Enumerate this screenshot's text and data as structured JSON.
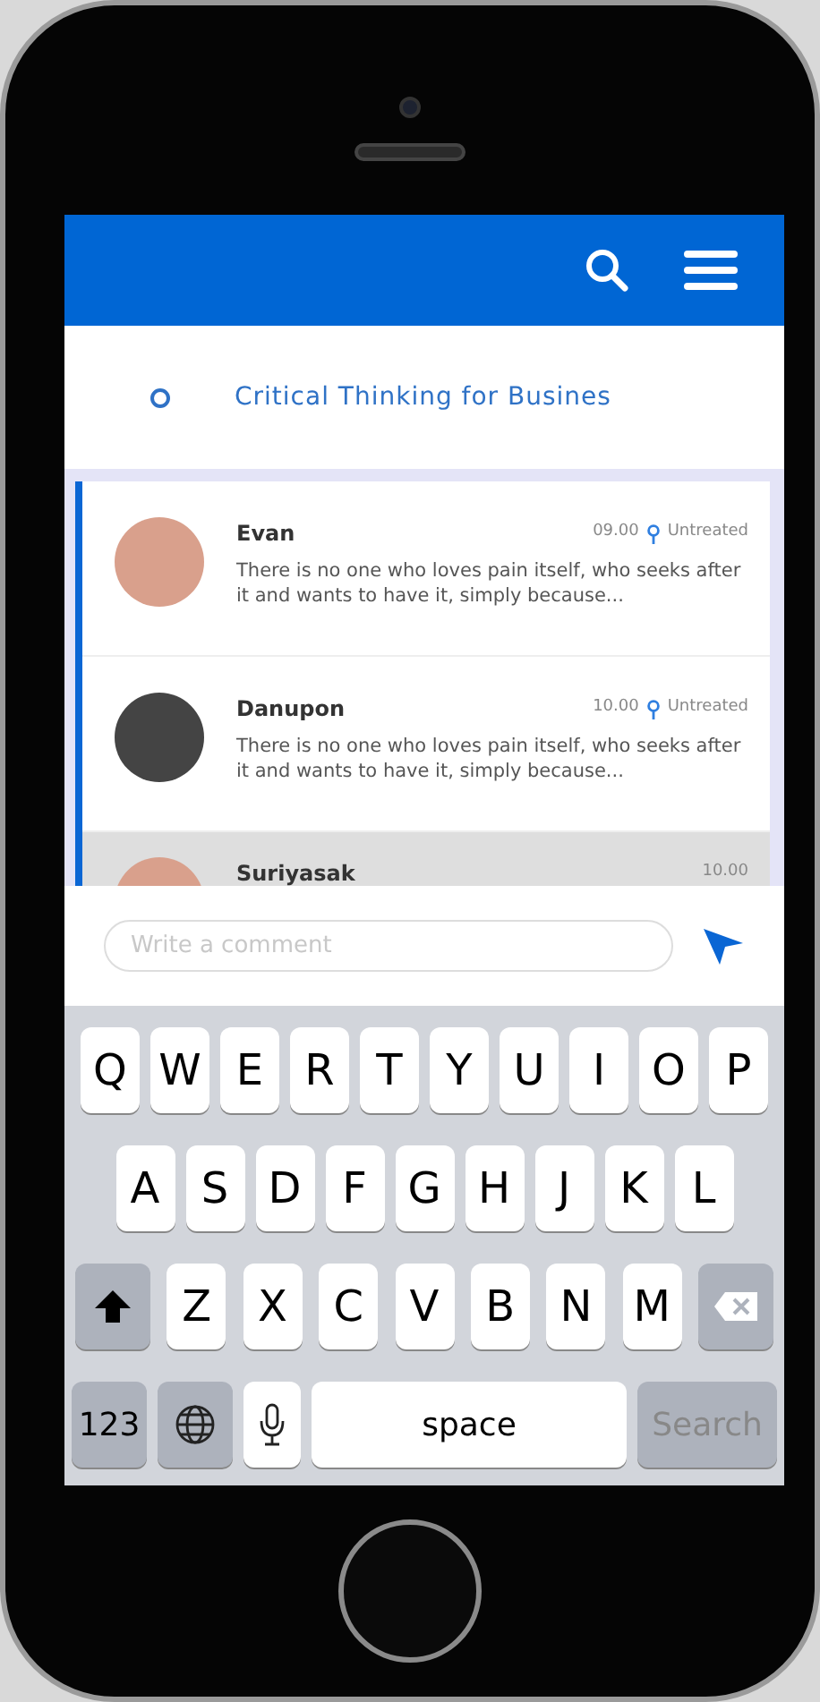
{
  "header": {
    "title": "Critical Thinking for Busines"
  },
  "messages": [
    {
      "name": "Evan",
      "time": "09.00",
      "status": "Untreated",
      "text": "There is no one who loves pain itself, who seeks after it and wants to have it, simply because...",
      "selected": false
    },
    {
      "name": "Danupon",
      "time": "10.00",
      "status": "Untreated",
      "text": "There is no one who loves pain itself, who seeks after it and wants to have it, simply because...",
      "selected": false
    },
    {
      "name": "Suriyasak",
      "time": "10.00",
      "selected": true
    }
  ],
  "comment": {
    "placeholder": "Write a comment"
  },
  "keyboard": [
    [
      {
        "kind": "letter",
        "label": "Q"
      },
      {
        "kind": "letter",
        "label": "W"
      },
      {
        "kind": "letter",
        "label": "E"
      },
      {
        "kind": "letter",
        "label": "R"
      },
      {
        "kind": "letter",
        "label": "T"
      },
      {
        "kind": "letter",
        "label": "Y"
      },
      {
        "kind": "letter",
        "label": "U"
      },
      {
        "kind": "letter",
        "label": "I"
      },
      {
        "kind": "letter",
        "label": "O"
      },
      {
        "kind": "letter",
        "label": "P"
      }
    ],
    [
      {
        "kind": "letter",
        "label": "A"
      },
      {
        "kind": "letter",
        "label": "S"
      },
      {
        "kind": "letter",
        "label": "D"
      },
      {
        "kind": "letter",
        "label": "F"
      },
      {
        "kind": "letter",
        "label": "G"
      },
      {
        "kind": "letter",
        "label": "H"
      },
      {
        "kind": "letter",
        "label": "J"
      },
      {
        "kind": "letter",
        "label": "K"
      },
      {
        "kind": "letter",
        "label": "L"
      }
    ],
    [
      {
        "kind": "shift"
      },
      {
        "kind": "letter",
        "label": "Z"
      },
      {
        "kind": "letter",
        "label": "X"
      },
      {
        "kind": "letter",
        "label": "C"
      },
      {
        "kind": "letter",
        "label": "V"
      },
      {
        "kind": "letter",
        "label": "B"
      },
      {
        "kind": "letter",
        "label": "N"
      },
      {
        "kind": "letter",
        "label": "M"
      },
      {
        "kind": "backspace"
      }
    ],
    [
      {
        "kind": "mode",
        "label": "123"
      },
      {
        "kind": "globe"
      },
      {
        "kind": "mic"
      },
      {
        "kind": "space",
        "label": "space"
      },
      {
        "kind": "return",
        "label": "Search"
      }
    ]
  ]
}
